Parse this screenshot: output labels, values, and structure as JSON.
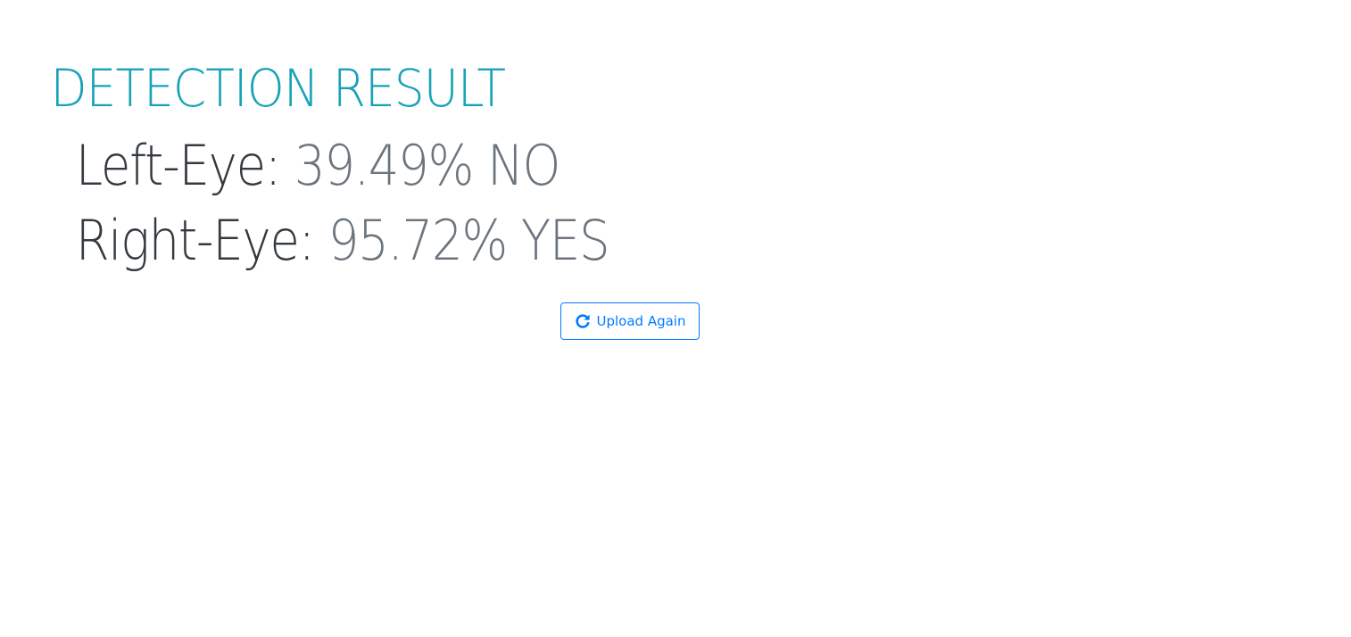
{
  "result": {
    "title": "DETECTION RESULT",
    "left_eye": {
      "label": "Left-Eye:",
      "value": "39.49% NO"
    },
    "right_eye": {
      "label": "Right-Eye:",
      "value": "95.72% YES"
    }
  },
  "actions": {
    "upload_again_label": "Upload Again",
    "upload_again_icon": "redo-icon"
  },
  "colors": {
    "title": "#17a2b8",
    "label": "#343a40",
    "value": "#6c757d",
    "button": "#007bff"
  }
}
